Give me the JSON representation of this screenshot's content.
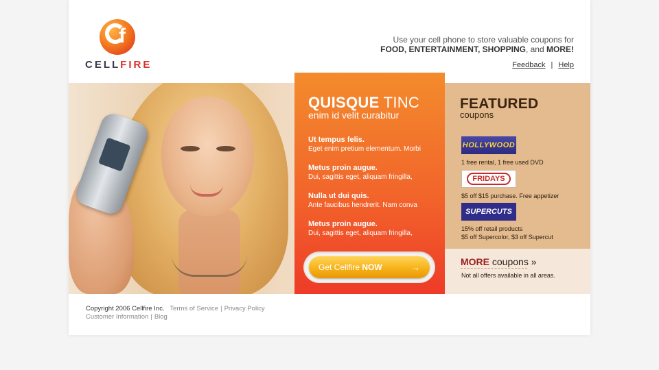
{
  "brand": {
    "name_part1": "CELL",
    "name_part2": "FIRE",
    "logo_icon": "cellfire-logo-icon"
  },
  "header": {
    "tagline_line1": "Use your cell phone to store valuable coupons for",
    "tagline_bold1": "FOOD, ENTERTAINMENT, SHOPPING",
    "tagline_and": ", and ",
    "tagline_bold2": "MORE!",
    "links": {
      "feedback": "Feedback",
      "separator": "|",
      "help": "Help"
    }
  },
  "promo": {
    "title_bold": "QUISQUE",
    "title_light": " TINC",
    "subtitle": "enim id velit curabitur",
    "items": [
      {
        "title": "Ut tempus felis.",
        "desc": "Eget enim pretium elementum. Morbi"
      },
      {
        "title": "Metus proin augue.",
        "desc": "Dui, sagittis eget, aliquam fringilla,"
      },
      {
        "title": "Nulla ut dui quis.",
        "desc": "Ante faucibus hendrerit. Nam conva"
      },
      {
        "title": "Metus proin augue.",
        "desc": "Dui, sagittis eget, aliquam fringilla,"
      }
    ],
    "cta": {
      "label_prefix": "Get Cellfire ",
      "label_bold": "NOW",
      "arrow": "→"
    }
  },
  "featured": {
    "heading": "FEATURED",
    "subheading": "coupons",
    "coupons": [
      {
        "brand_label": "HOLLYWOOD",
        "text1": "1 free rental,  1 free used DVD",
        "text2": ""
      },
      {
        "brand_label": "FRIDAYS",
        "text1": "$5 off $15 purchase.  Free appetizer",
        "text2": ""
      },
      {
        "brand_label": "SUPERCUTS",
        "text1": "15% off retail products",
        "text2": "$5 off Supercolor,  $3 off Supercut"
      }
    ],
    "more": {
      "bold": "MORE",
      "rest": " coupons",
      "chevron": "»",
      "note": "Not all offers available in all areas."
    }
  },
  "footer": {
    "copyright": "Copyright 2006 Cellfire Inc.",
    "terms": "Terms of Service",
    "privacy": "Privacy Policy",
    "customer": "Customer Information",
    "blog": "Blog",
    "sep": "|"
  },
  "colors": {
    "accent_orange": "#f2652b",
    "featured_bg": "#e3bb8f",
    "more_bg": "#f5e7da",
    "brand_red": "#d8322a"
  }
}
